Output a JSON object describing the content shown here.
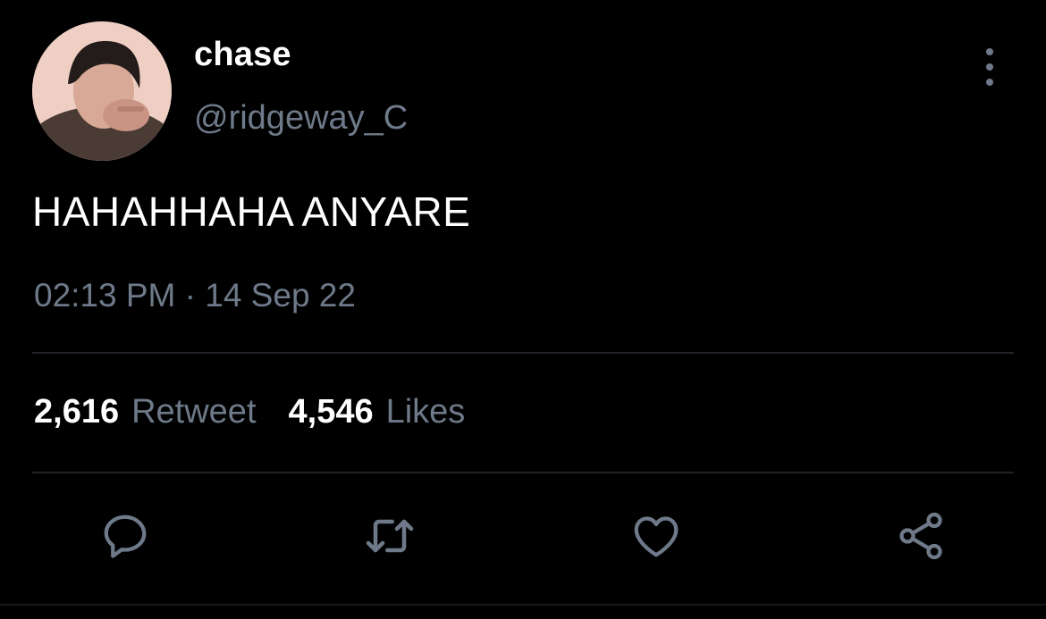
{
  "user": {
    "display_name": "chase",
    "handle": "@ridgeway_C"
  },
  "tweet": {
    "text": "HAHAHHAHA ANYARE",
    "timestamp": "02:13 PM · 14 Sep 22"
  },
  "stats": {
    "retweets_count": "2,616",
    "retweets_label": "Retweet",
    "likes_count": "4,546",
    "likes_label": "Likes"
  },
  "actions": {
    "reply_icon": "reply-bubble-icon",
    "retweet_icon": "retweet-arrows-icon",
    "like_icon": "heart-icon",
    "share_icon": "share-nodes-icon"
  },
  "colors": {
    "background": "#000000",
    "primary_text": "#ffffff",
    "secondary_text": "#6e7a89",
    "divider": "#1f2328"
  }
}
